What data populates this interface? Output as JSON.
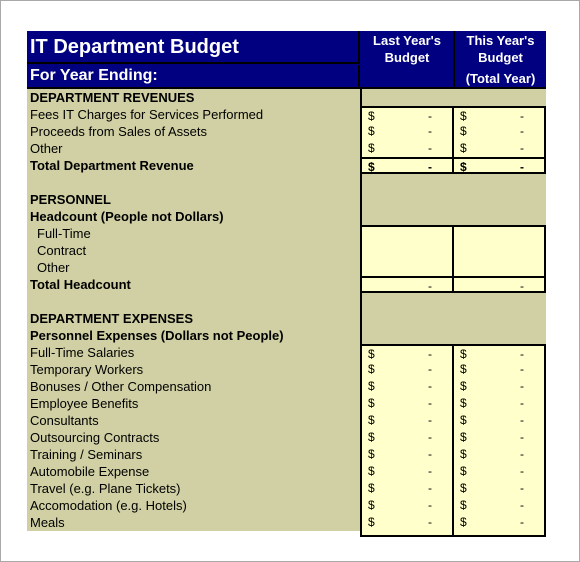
{
  "header": {
    "title": "IT Department Budget",
    "subtitle": "For Year Ending:",
    "col_last_line1": "Last Year's",
    "col_last_line2": "Budget",
    "col_this_line1": "This Year's",
    "col_this_line2": "Budget",
    "col_this_line3": "(Total Year)"
  },
  "colors": {
    "header_bg": "#000080",
    "label_bg": "#d0d0a4",
    "input_bg": "#ffffcc"
  },
  "currency": "$",
  "empty_value": "-",
  "revenues": {
    "section": "DEPARTMENT REVENUES",
    "items": [
      {
        "label": "Fees IT Charges for Services Performed",
        "last": "-",
        "this": "-"
      },
      {
        "label": "Proceeds from Sales of Assets",
        "last": "-",
        "this": "-"
      },
      {
        "label": "Other",
        "last": "-",
        "this": "-"
      }
    ],
    "total": {
      "label": "Total Department Revenue",
      "last": "-",
      "this": "-"
    }
  },
  "personnel": {
    "section": "PERSONNEL",
    "subheading": "Headcount (People not Dollars)",
    "items": [
      {
        "label": "Full-Time",
        "last": "",
        "this": ""
      },
      {
        "label": "Contract",
        "last": "",
        "this": ""
      },
      {
        "label": "Other",
        "last": "",
        "this": ""
      }
    ],
    "total": {
      "label": "Total Headcount",
      "last": "-",
      "this": "-"
    }
  },
  "expenses": {
    "section": "DEPARTMENT EXPENSES",
    "subheading": "Personnel Expenses (Dollars not People)",
    "items": [
      {
        "label": "Full-Time Salaries",
        "last": "-",
        "this": "-"
      },
      {
        "label": "Temporary Workers",
        "last": "-",
        "this": "-"
      },
      {
        "label": "Bonuses / Other Compensation",
        "last": "-",
        "this": "-"
      },
      {
        "label": "Employee Benefits",
        "last": "-",
        "this": "-"
      },
      {
        "label": "Consultants",
        "last": "-",
        "this": "-"
      },
      {
        "label": "Outsourcing Contracts",
        "last": "-",
        "this": "-"
      },
      {
        "label": "Training / Seminars",
        "last": "-",
        "this": "-"
      },
      {
        "label": "Automobile Expense",
        "last": "-",
        "this": "-"
      },
      {
        "label": "Travel (e.g. Plane Tickets)",
        "last": "-",
        "this": "-"
      },
      {
        "label": "Accomodation (e.g. Hotels)",
        "last": "-",
        "this": "-"
      },
      {
        "label": "Meals",
        "last": "-",
        "this": "-"
      }
    ]
  }
}
